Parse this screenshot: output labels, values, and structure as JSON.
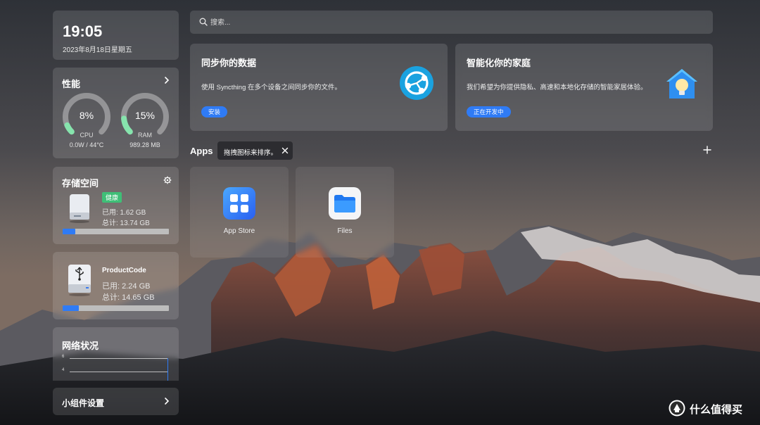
{
  "clock": {
    "time": "19:05",
    "date": "2023年8月18日星期五"
  },
  "performance": {
    "title": "性能",
    "cpu": {
      "value": "8%",
      "label": "CPU",
      "detail": "0.0W / 44°C",
      "fraction": 0.08
    },
    "ram": {
      "value": "15%",
      "label": "RAM",
      "detail": "989.28 MB",
      "fraction": 0.15
    }
  },
  "storage": {
    "title": "存储空间",
    "disks": [
      {
        "name": "",
        "badge": "健康",
        "used": "已用: 1.62 GB",
        "total": "总计: 13.74 GB",
        "fraction": 0.118
      },
      {
        "name": "ProductCode",
        "used": "已用: 2.24 GB",
        "total": "总计: 14.65 GB",
        "fraction": 0.153
      }
    ]
  },
  "network": {
    "title": "网络状况",
    "ticks": [
      "6",
      "4"
    ]
  },
  "widget_settings": {
    "label": "小组件设置"
  },
  "search": {
    "placeholder": "搜索..."
  },
  "promos": {
    "sync": {
      "title": "同步你的数据",
      "desc": "使用 Syncthing 在多个设备之间同步你的文件。",
      "button": "安装"
    },
    "home": {
      "title": "智能化你的家庭",
      "desc": "我们希望为你提供隐私、高速和本地化存储的智能家居体验。",
      "button": "正在开发中"
    }
  },
  "apps": {
    "label": "Apps",
    "tooltip": "拖拽图标来排序。",
    "items": [
      {
        "name": "App Store"
      },
      {
        "name": "Files"
      }
    ]
  },
  "watermark": {
    "text": "什么值得买"
  },
  "colors": {
    "accent": "#2f7bf5",
    "gauge": "#86e4ad",
    "healthy": "#3fbf77"
  }
}
